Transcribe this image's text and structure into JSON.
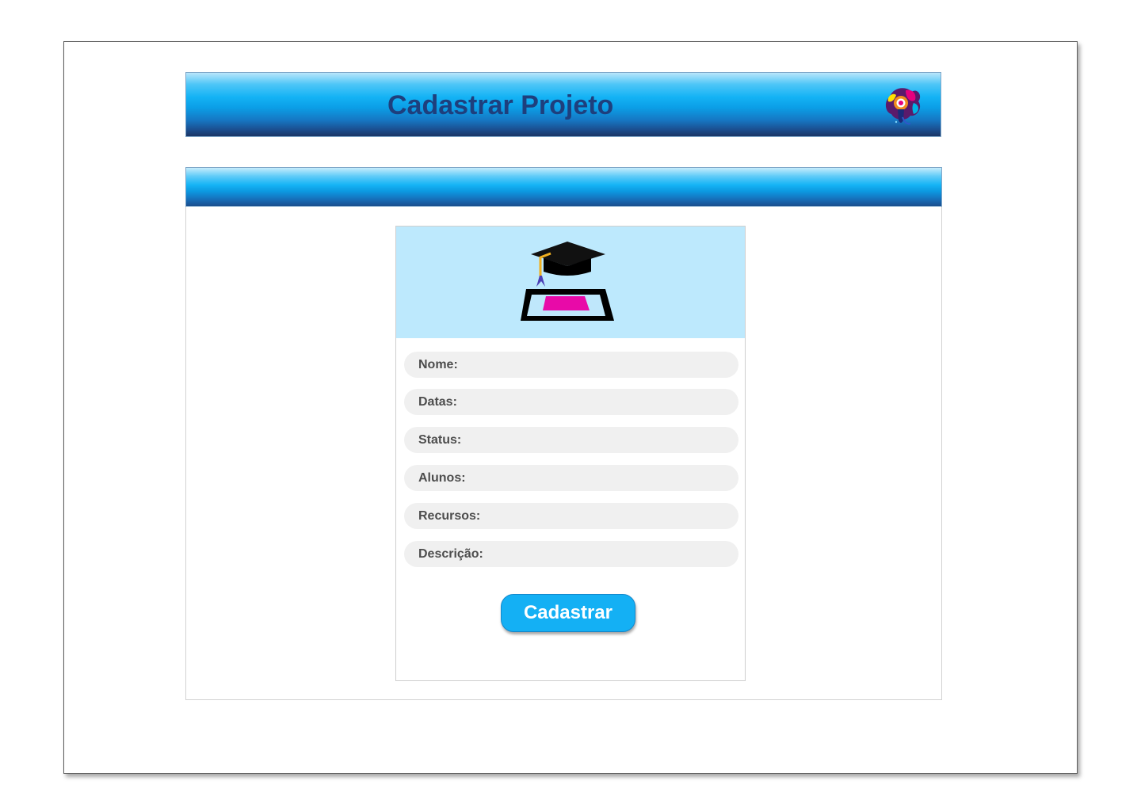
{
  "header": {
    "title": "Cadastrar Projeto",
    "logo_icon": "lightbulb-paint-icon"
  },
  "form": {
    "hero_icon": "graduation-cap-tablet-icon",
    "fields": [
      {
        "label": "Nome:"
      },
      {
        "label": "Datas:"
      },
      {
        "label": "Status:"
      },
      {
        "label": "Alunos:"
      },
      {
        "label": "Recursos:"
      },
      {
        "label": "Descrição:"
      }
    ],
    "submit_label": "Cadastrar"
  },
  "colors": {
    "header_gradient_top": "#14b3f5",
    "header_gradient_bottom": "#1b3566",
    "title_color": "#1e3f7d",
    "hero_background": "#bde9fd",
    "field_background": "#f0f0f0",
    "button_background": "#14b0f4"
  }
}
